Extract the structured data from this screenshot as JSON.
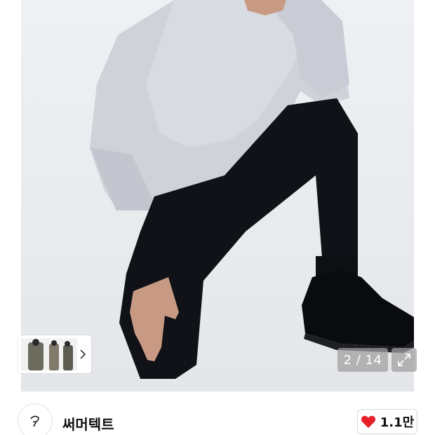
{
  "gallery": {
    "counter": "2 / 14",
    "icons": {
      "thumb_next": "chevron-right-icon",
      "expand": "expand-icon"
    }
  },
  "brand": {
    "name": "써머텍트",
    "logo_icon": "brand-logo-icon"
  },
  "like": {
    "count": "1.1만",
    "icon": "heart-icon",
    "color": "#e8202a"
  }
}
